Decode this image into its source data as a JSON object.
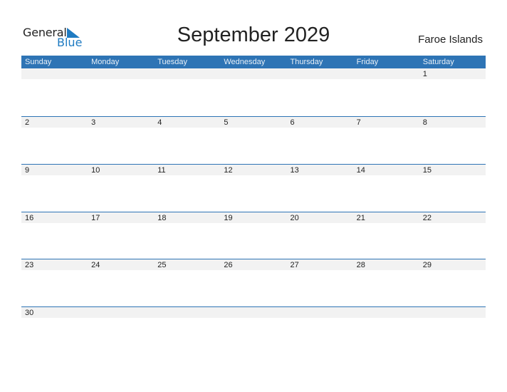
{
  "logo": {
    "line1": "General",
    "line2": "Blue"
  },
  "title": "September 2029",
  "country": "Faroe Islands",
  "weekdays": [
    "Sunday",
    "Monday",
    "Tuesday",
    "Wednesday",
    "Thursday",
    "Friday",
    "Saturday"
  ],
  "weeks": [
    [
      "",
      "",
      "",
      "",
      "",
      "",
      "1"
    ],
    [
      "2",
      "3",
      "4",
      "5",
      "6",
      "7",
      "8"
    ],
    [
      "9",
      "10",
      "11",
      "12",
      "13",
      "14",
      "15"
    ],
    [
      "16",
      "17",
      "18",
      "19",
      "20",
      "21",
      "22"
    ],
    [
      "23",
      "24",
      "25",
      "26",
      "27",
      "28",
      "29"
    ],
    [
      "30",
      "",
      "",
      "",
      "",
      "",
      ""
    ]
  ],
  "colors": {
    "accent": "#2e74b5",
    "strip": "#f2f2f2"
  }
}
